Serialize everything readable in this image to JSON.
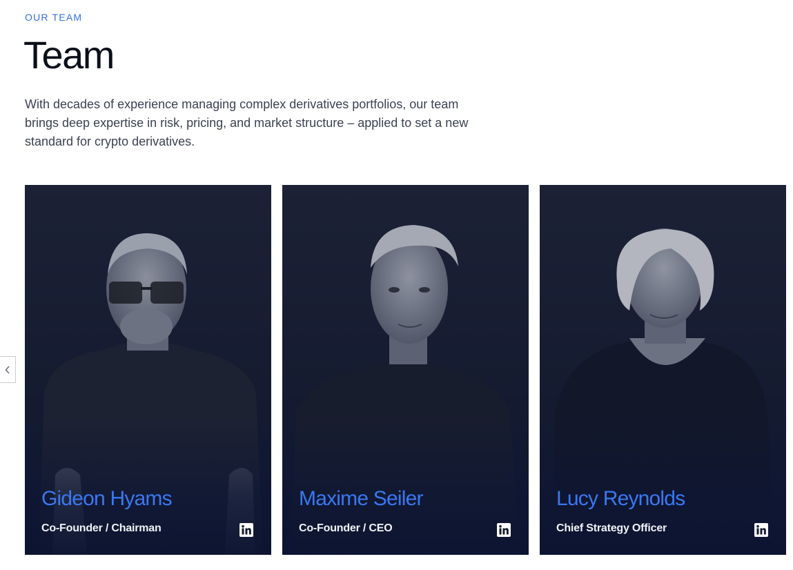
{
  "section": {
    "eyebrow": "OUR TEAM",
    "title": "Team",
    "intro": "With decades of experience managing complex derivatives portfolios, our team brings deep expertise in risk, pricing, and market structure –  applied to set a new standard for crypto derivatives."
  },
  "carousel": {
    "prev_icon": "chevron-left-icon"
  },
  "team": [
    {
      "name": "Gideon Hyams",
      "role": "Co-Founder / Chairman",
      "icon": "linkedin-icon"
    },
    {
      "name": "Maxime Seiler",
      "role": "Co-Founder / CEO",
      "icon": "linkedin-icon"
    },
    {
      "name": "Lucy Reynolds",
      "role": "Chief Strategy Officer",
      "icon": "linkedin-icon"
    }
  ],
  "colors": {
    "accent": "#2f6fe4",
    "name_blue": "#3a78f2",
    "card_bg": "#1a1f35"
  }
}
